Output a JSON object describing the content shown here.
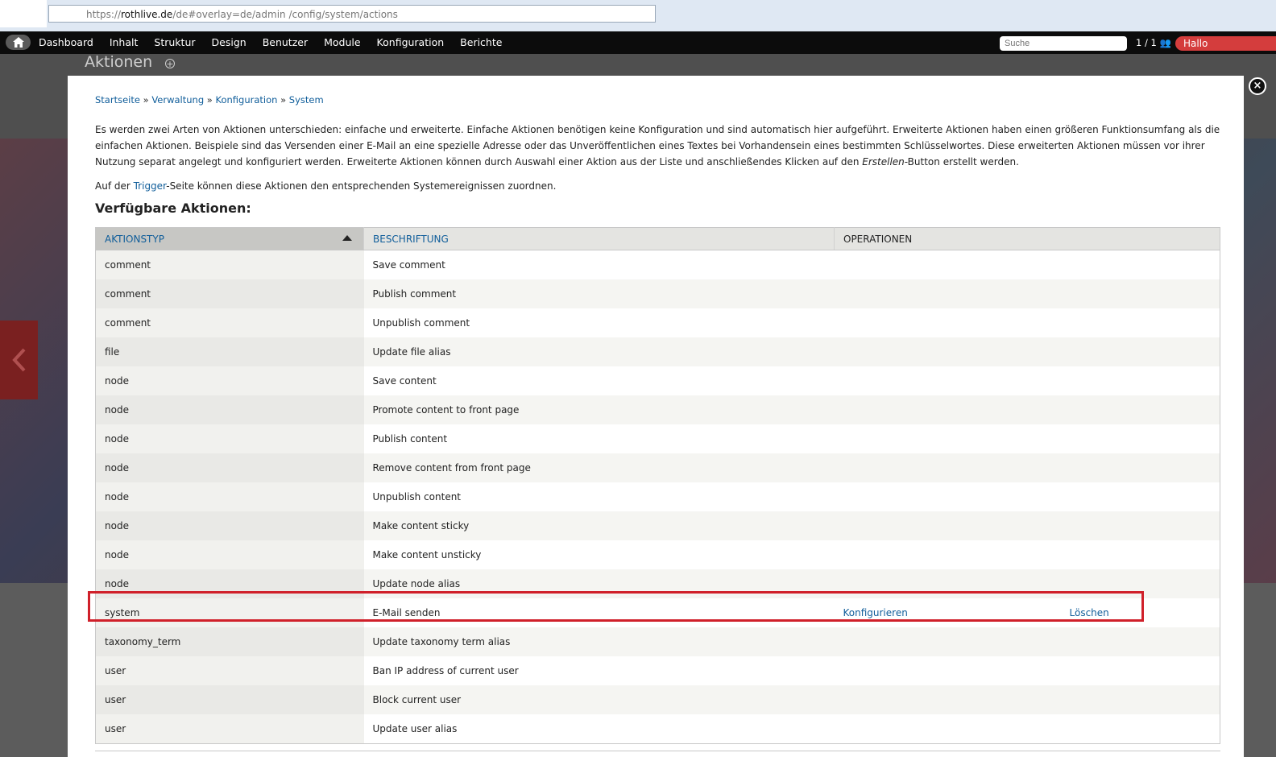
{
  "browser": {
    "url_prefix": "https://",
    "url_host": "rothlive.de",
    "url_path": "/de#overlay=de/admin /config/system/actions"
  },
  "toolbar": {
    "menu": [
      "Dashboard",
      "Inhalt",
      "Struktur",
      "Design",
      "Benutzer",
      "Module",
      "Konfiguration",
      "Berichte"
    ],
    "search_placeholder": "Suche",
    "user_count": "1 / 1",
    "greeting": "Hallo"
  },
  "page": {
    "title": "Aktionen"
  },
  "breadcrumb": {
    "items": [
      "Startseite",
      "Verwaltung",
      "Konfiguration",
      "System"
    ],
    "separator": "»"
  },
  "intro": {
    "text_before_em": "Es werden zwei Arten von Aktionen unterschieden: einfache und erweiterte. Einfache Aktionen benötigen keine Konfiguration und sind automatisch hier aufgeführt. Erweiterte Aktionen haben einen größeren Funktionsumfang als die einfachen Aktionen. Beispiele sind das Versenden einer E-Mail an eine spezielle Adresse oder das Unveröffentlichen eines Textes bei Vorhandensein eines bestimmten Schlüsselwortes. Diese erweiterten Aktionen müssen vor ihrer Nutzung separat angelegt und konfiguriert werden. Erweiterte Aktionen können durch Auswahl einer Aktion aus der Liste und anschließendes Klicken auf den ",
    "em": "Erstellen",
    "text_after_em": "-Button erstellt werden."
  },
  "trigger": {
    "before": "Auf der ",
    "link": "Trigger",
    "after": "-Seite können diese Aktionen den entsprechenden Systemereignissen zuordnen."
  },
  "section_title": "Verfügbare Aktionen:",
  "table": {
    "headers": {
      "type": "AKTIONSTYP",
      "label": "BESCHRIFTUNG",
      "operations": "OPERATIONEN"
    },
    "rows": [
      {
        "type": "comment",
        "label": "Save comment",
        "configure": "",
        "delete": ""
      },
      {
        "type": "comment",
        "label": "Publish comment",
        "configure": "",
        "delete": ""
      },
      {
        "type": "comment",
        "label": "Unpublish comment",
        "configure": "",
        "delete": ""
      },
      {
        "type": "file",
        "label": "Update file alias",
        "configure": "",
        "delete": ""
      },
      {
        "type": "node",
        "label": "Save content",
        "configure": "",
        "delete": ""
      },
      {
        "type": "node",
        "label": "Promote content to front page",
        "configure": "",
        "delete": ""
      },
      {
        "type": "node",
        "label": "Publish content",
        "configure": "",
        "delete": ""
      },
      {
        "type": "node",
        "label": "Remove content from front page",
        "configure": "",
        "delete": ""
      },
      {
        "type": "node",
        "label": "Unpublish content",
        "configure": "",
        "delete": ""
      },
      {
        "type": "node",
        "label": "Make content sticky",
        "configure": "",
        "delete": ""
      },
      {
        "type": "node",
        "label": "Make content unsticky",
        "configure": "",
        "delete": ""
      },
      {
        "type": "node",
        "label": "Update node alias",
        "configure": "",
        "delete": ""
      },
      {
        "type": "system",
        "label": "E-Mail senden",
        "configure": "Konfigurieren",
        "delete": "Löschen"
      },
      {
        "type": "taxonomy_term",
        "label": "Update taxonomy term alias",
        "configure": "",
        "delete": ""
      },
      {
        "type": "user",
        "label": "Ban IP address of current user",
        "configure": "",
        "delete": ""
      },
      {
        "type": "user",
        "label": "Block current user",
        "configure": "",
        "delete": ""
      },
      {
        "type": "user",
        "label": "Update user alias",
        "configure": "",
        "delete": ""
      }
    ]
  },
  "colors": {
    "link": "#0f5d9a",
    "highlight": "#d0202a",
    "toolbar": "#0c0c0c",
    "greeting_badge": "#d43d3d"
  }
}
